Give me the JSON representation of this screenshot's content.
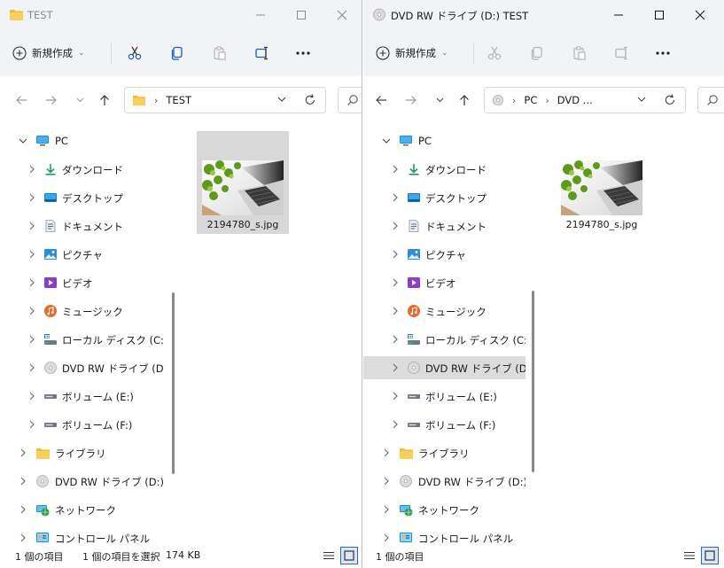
{
  "colors": {
    "accent": "#2a6ab7",
    "selected": "#dcdcdc",
    "chrome": "#f1f3f6"
  },
  "left_window": {
    "title": "TEST",
    "title_icon": "folder-icon",
    "toolbar": {
      "new_label": "新規作成"
    },
    "address": {
      "crumbs": [
        "TEST"
      ]
    },
    "tree": [
      {
        "label": "PC",
        "icon": "pc-icon",
        "expanded": true
      },
      {
        "label": "ダウンロード",
        "icon": "download-icon"
      },
      {
        "label": "デスクトップ",
        "icon": "desktop-icon"
      },
      {
        "label": "ドキュメント",
        "icon": "documents-icon"
      },
      {
        "label": "ピクチャ",
        "icon": "pictures-icon"
      },
      {
        "label": "ビデオ",
        "icon": "video-icon"
      },
      {
        "label": "ミュージック",
        "icon": "music-icon"
      },
      {
        "label": "ローカル ディスク (C:)",
        "icon": "local-disk-icon"
      },
      {
        "label": "DVD RW ドライブ (D:) TEST",
        "icon": "dvd-icon"
      },
      {
        "label": "ボリューム (E:)",
        "icon": "volume-icon"
      },
      {
        "label": "ボリューム (F:)",
        "icon": "volume-icon"
      },
      {
        "label": "ライブラリ",
        "icon": "library-icon"
      },
      {
        "label": "DVD RW ドライブ (D:) TEST",
        "icon": "dvd-icon"
      },
      {
        "label": "ネットワーク",
        "icon": "network-icon"
      },
      {
        "label": "コントロール パネル",
        "icon": "control-panel-icon"
      }
    ],
    "files": [
      {
        "name": "2194780_s.jpg",
        "selected": true
      }
    ],
    "status": {
      "count": "1 個の項目",
      "selection": "1 個の項目を選択",
      "size": "174 KB"
    }
  },
  "right_window": {
    "title": "DVD RW ドライブ (D:) TEST",
    "title_icon": "dvd-icon",
    "toolbar": {
      "new_label": "新規作成"
    },
    "address": {
      "crumbs": [
        "PC",
        "DVD ..."
      ]
    },
    "tree": [
      {
        "label": "PC",
        "icon": "pc-icon",
        "expanded": true
      },
      {
        "label": "ダウンロード",
        "icon": "download-icon"
      },
      {
        "label": "デスクトップ",
        "icon": "desktop-icon"
      },
      {
        "label": "ドキュメント",
        "icon": "documents-icon"
      },
      {
        "label": "ピクチャ",
        "icon": "pictures-icon"
      },
      {
        "label": "ビデオ",
        "icon": "video-icon"
      },
      {
        "label": "ミュージック",
        "icon": "music-icon"
      },
      {
        "label": "ローカル ディスク (C:)",
        "icon": "local-disk-icon"
      },
      {
        "label": "DVD RW ドライブ (D:) TEST",
        "icon": "dvd-icon",
        "selected": true
      },
      {
        "label": "ボリューム (E:)",
        "icon": "volume-icon"
      },
      {
        "label": "ボリューム (F:)",
        "icon": "volume-icon"
      },
      {
        "label": "ライブラリ",
        "icon": "library-icon"
      },
      {
        "label": "DVD RW ドライブ (D:) TEST",
        "icon": "dvd-icon"
      },
      {
        "label": "ネットワーク",
        "icon": "network-icon"
      },
      {
        "label": "コントロール パネル",
        "icon": "control-panel-icon"
      }
    ],
    "files": [
      {
        "name": "2194780_s.jpg",
        "selected": false
      }
    ],
    "status": {
      "count": "1 個の項目"
    }
  }
}
